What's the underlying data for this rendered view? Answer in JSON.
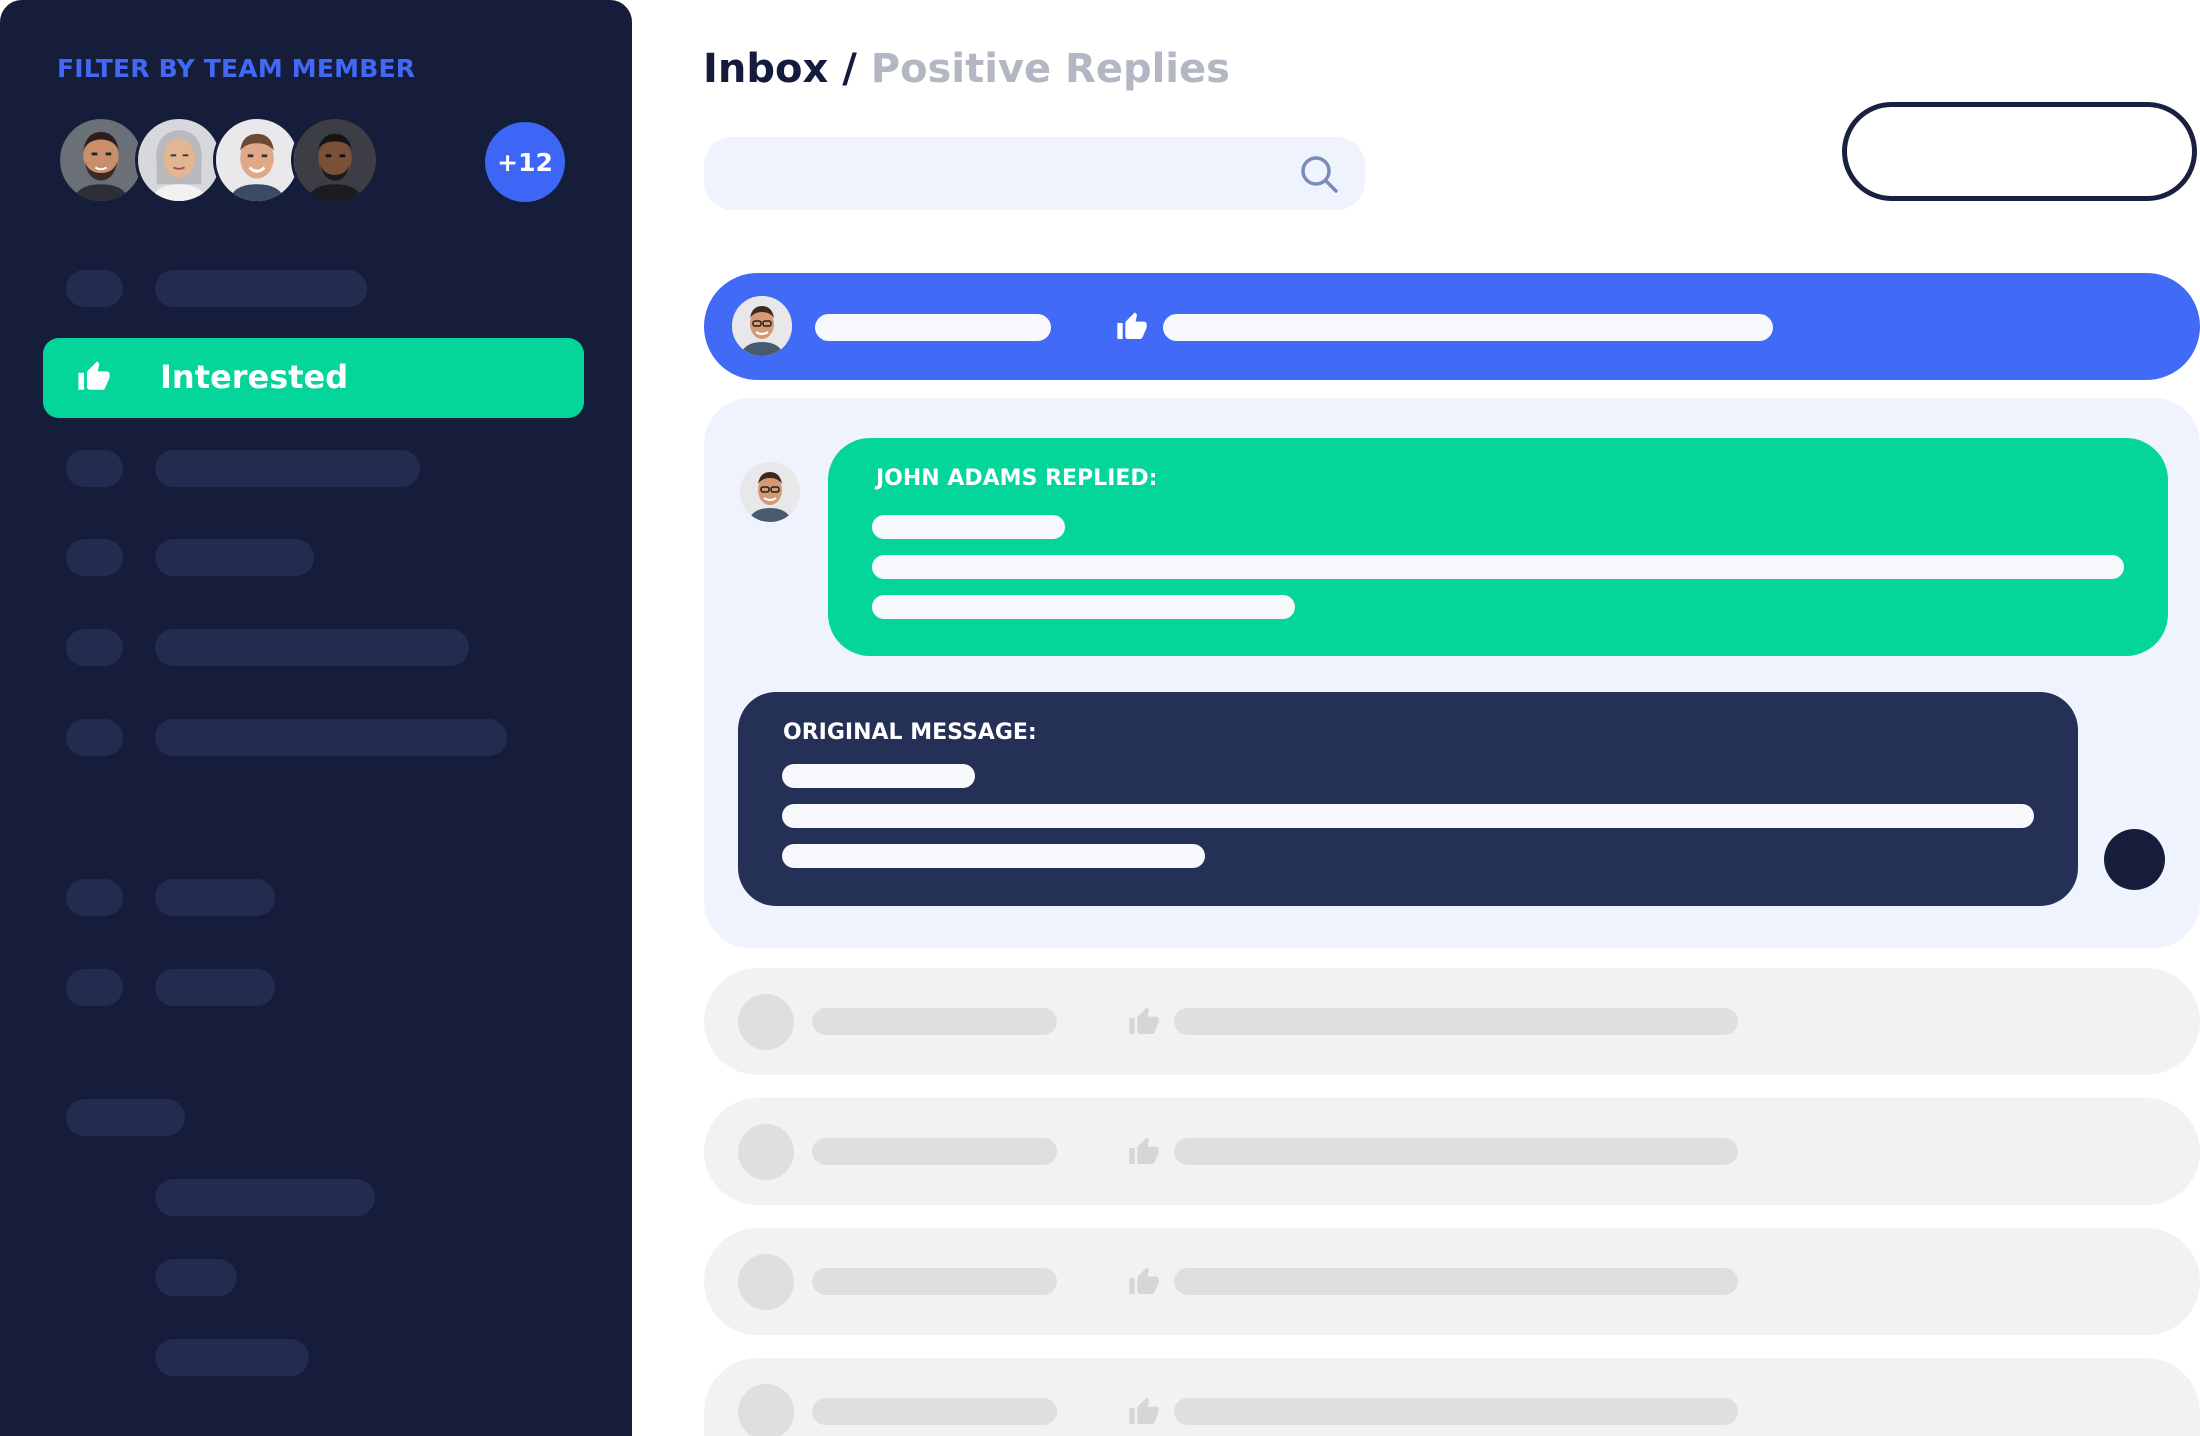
{
  "sidebar": {
    "filter_title": "FILTER BY TEAM MEMBER",
    "avatars": [
      {
        "icon": "avatar-man-beard"
      },
      {
        "icon": "avatar-woman-grey-hair"
      },
      {
        "icon": "avatar-man-smiling"
      },
      {
        "icon": "avatar-man-dark"
      }
    ],
    "more_count": "+12",
    "active_item": {
      "label": "Interested",
      "icon": "thumbs-up-icon"
    }
  },
  "header": {
    "breadcrumb_root": "Inbox",
    "breadcrumb_sep": " / ",
    "breadcrumb_current": "Positive Replies"
  },
  "thread": {
    "reply_title": "JOHN ADAMS REPLIED:",
    "original_title": "ORIGINAL MESSAGE:"
  },
  "colors": {
    "sidebar_bg": "#161d3a",
    "accent_blue": "#416bf7",
    "accent_green": "#04d59a",
    "dark_card": "#243055"
  }
}
